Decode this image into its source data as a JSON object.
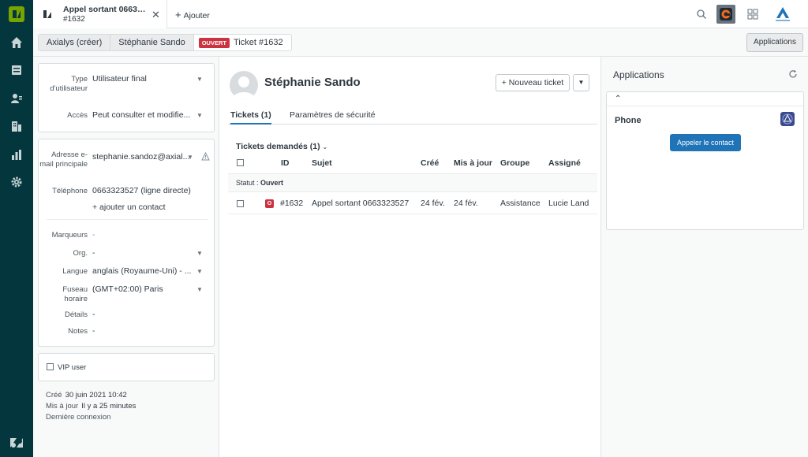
{
  "topbar": {
    "tab_title": "Appel sortant 066332...",
    "tab_subtitle": "#1632",
    "add_label": "Ajouter"
  },
  "breadcrumb": {
    "org": "Axialys (créer)",
    "user": "Stéphanie Sando",
    "status": "OUVERT",
    "ticket": "Ticket #1632"
  },
  "header": {
    "apps_button": "Applications"
  },
  "user_panel": {
    "type_label": "Type d'utilisateur",
    "type_value": "Utilisateur final",
    "access_label": "Accès",
    "access_value": "Peut consulter et modifie...",
    "email_label": "Adresse e-mail principale",
    "email_value": "stephanie.sandoz@axial...",
    "phone_label": "Téléphone",
    "phone_value": "0663323527 (ligne directe)",
    "add_contact": "+ ajouter un contact",
    "tags_label": "Marqueurs",
    "tags_value": "-",
    "org_label": "Org.",
    "org_value": "-",
    "lang_label": "Langue",
    "lang_value": "anglais (Royaume-Uni) - ...",
    "tz_label": "Fuseau horaire",
    "tz_value": "(GMT+02:00) Paris",
    "details_label": "Détails",
    "details_value": "-",
    "notes_label": "Notes",
    "notes_value": "-",
    "vip_label": "VIP user",
    "created_label": "Créé",
    "created_value": "30 juin 2021 10:42",
    "updated_label": "Mis à jour",
    "updated_value": "Il y a 25 minutes",
    "last_login_label": "Dernière connexion"
  },
  "main": {
    "name": "Stéphanie Sando",
    "new_ticket": "+ Nouveau ticket",
    "tabs": [
      "Tickets (1)",
      "Paramètres de sécurité"
    ],
    "tickets_heading": "Tickets demandés (1)",
    "columns": [
      "ID",
      "Sujet",
      "Créé",
      "Mis à jour",
      "Groupe",
      "Assigné"
    ],
    "status_group_label": "Statut :",
    "status_group_value": "Ouvert",
    "row": {
      "status_letter": "O",
      "id": "#1632",
      "subject": "Appel sortant 0663323527",
      "created": "24 fév.",
      "updated": "24 fév.",
      "group": "Assistance",
      "assignee": "Lucie Land"
    }
  },
  "apps_panel": {
    "title": "Applications",
    "app_name": "Phone",
    "call_button": "Appeler le contact"
  },
  "colors": {
    "nav": "#03363d",
    "accent": "#1f73b7",
    "open_status": "#cc3340"
  }
}
